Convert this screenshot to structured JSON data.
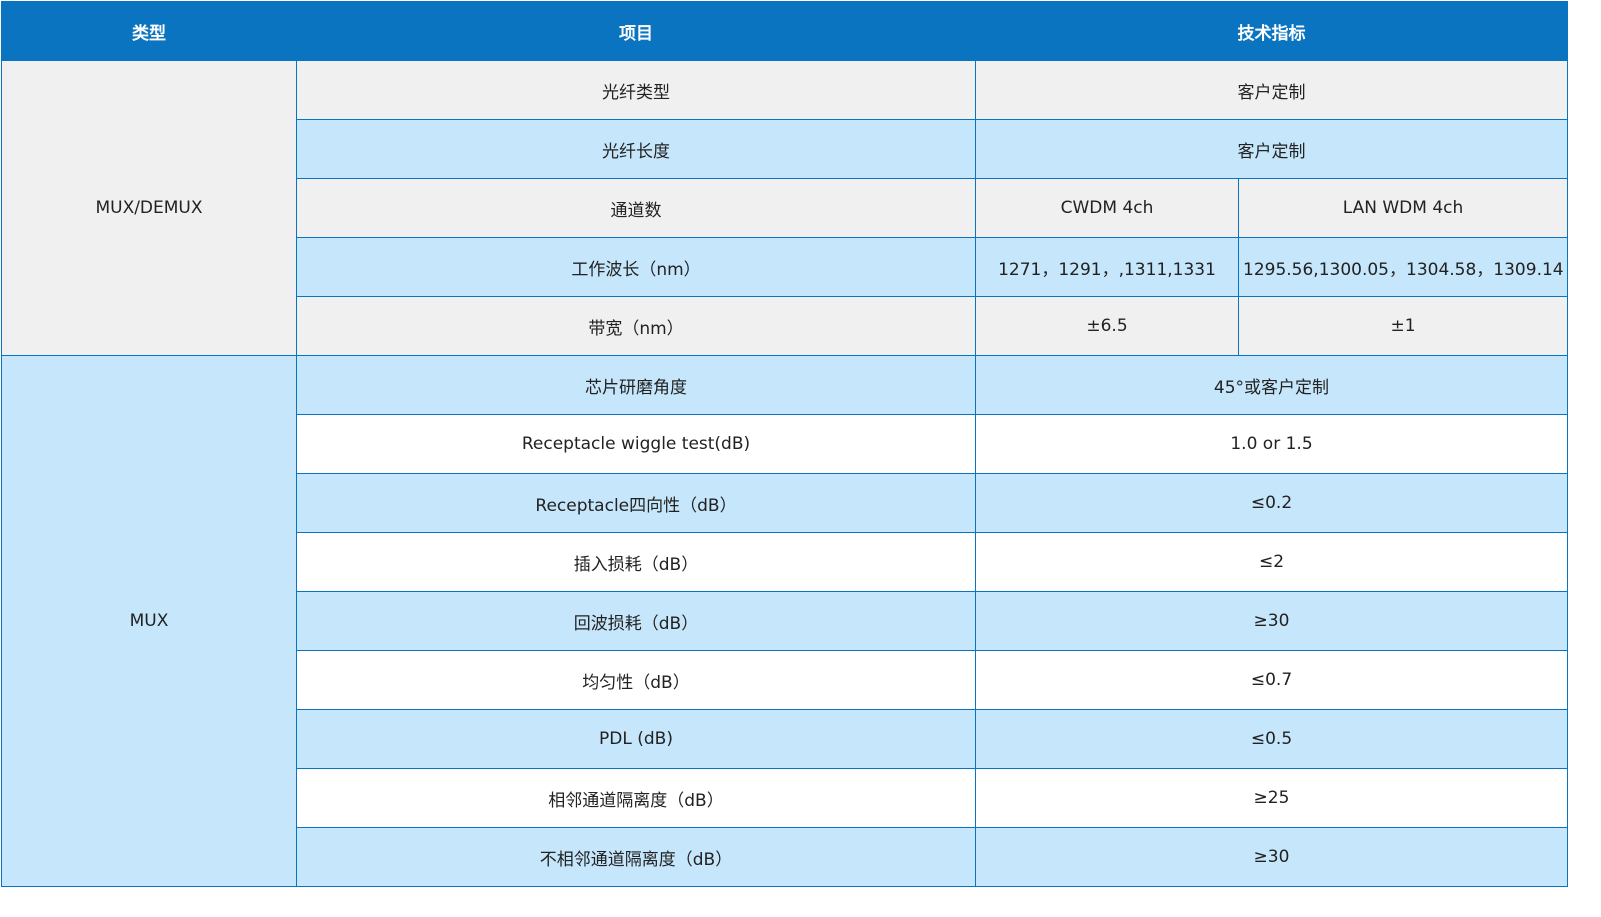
{
  "header": {
    "type": "类型",
    "item": "项目",
    "spec": "技术指标"
  },
  "groups": {
    "mux_demux": "MUX/DEMUX",
    "mux": "MUX"
  },
  "rows": [
    {
      "item": "光纤类型",
      "value": "客户定制"
    },
    {
      "item": "光纤长度",
      "value": "客户定制"
    },
    {
      "item": "通道数",
      "value_a": "CWDM 4ch",
      "value_b": "LAN WDM 4ch"
    },
    {
      "item": "工作波长（nm）",
      "value_a": "1271，1291，,1311,1331",
      "value_b": "1295.56,1300.05，1304.58，1309.14"
    },
    {
      "item": "带宽（nm）",
      "value_a": "±6.5",
      "value_b": "±1"
    },
    {
      "item": "芯片研磨角度",
      "value": "45°或客户定制"
    },
    {
      "item": "Receptacle wiggle test(dB)",
      "value": "1.0 or 1.5"
    },
    {
      "item": "Receptacle四向性（dB）",
      "value": "≤0.2"
    },
    {
      "item": "插入损耗（dB）",
      "value": "≤2"
    },
    {
      "item": "回波损耗（dB）",
      "value": "≥30"
    },
    {
      "item": "均匀性（dB）",
      "value": "≤0.7"
    },
    {
      "item": "PDL (dB)",
      "value": "≤0.5"
    },
    {
      "item": "相邻通道隔离度（dB）",
      "value": "≥25"
    },
    {
      "item": "不相邻通道隔离度（dB）",
      "value": "≥30"
    }
  ],
  "colors": {
    "header_bg": "#0a74c1",
    "row_grey": "#f0f0f0",
    "row_blue": "#c6e6fb",
    "row_white": "#ffffff"
  }
}
